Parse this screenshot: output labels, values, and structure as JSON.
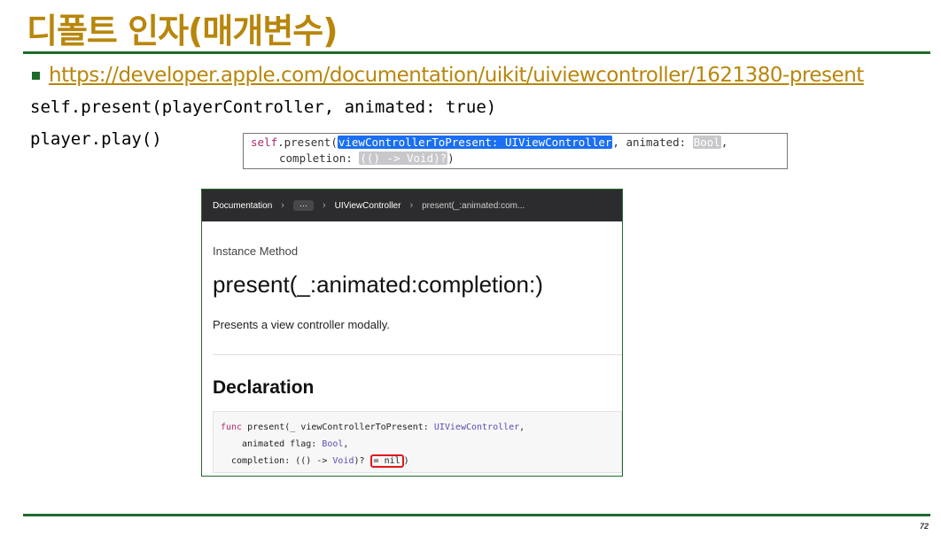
{
  "slide": {
    "title": "디폴트 인자(매개변수)",
    "link": "https://developer.apple.com/documentation/uikit/uiviewcontroller/1621380-present",
    "code_lines": [
      "self.present(playerController, animated: true)",
      "player.play()"
    ],
    "page_number": "72"
  },
  "signature": {
    "self": "self",
    "method": ".present(",
    "param1": "viewControllerToPresent: UIViewController",
    "comma1": ",",
    "animated": " animated: ",
    "bool": "Bool",
    "comma2": ",",
    "completion": "completion: ",
    "closure_type": "(() -> Void)?",
    "close": ")"
  },
  "doc": {
    "nav": {
      "documentation": "Documentation",
      "sep": "›",
      "dots": "···",
      "class": "UIViewController",
      "current": "present(_:animated:com..."
    },
    "eyebrow": "Instance Method",
    "title": "present(_:animated:completion:)",
    "abstract": "Presents a view controller modally.",
    "declaration_heading": "Declaration",
    "decl": {
      "func": "func",
      "l1_a": " present(_ viewControllerToPresent: ",
      "l1_type": "UIViewController",
      "l1_b": ",",
      "l2_a": "animated flag: ",
      "l2_type": "Bool",
      "l2_b": ",",
      "l3_a": "completion: (() -> ",
      "l3_type": "Void",
      "l3_b": ")? ",
      "default": "= nil",
      "l3_c": ")"
    }
  },
  "colors": {
    "title": "#b8860b",
    "rule": "#1f6b2b",
    "highlight_blue": "#1a6ff2",
    "highlight_red": "#e0181b"
  }
}
